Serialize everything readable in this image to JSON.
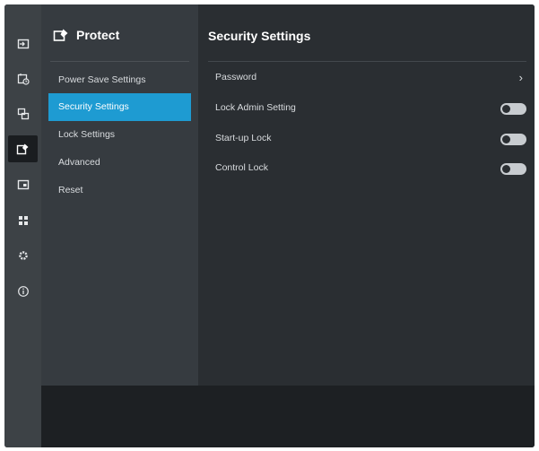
{
  "rail": {
    "icons": [
      {
        "name": "input-icon",
        "active": false
      },
      {
        "name": "schedule-icon",
        "active": false
      },
      {
        "name": "multi-picture-icon",
        "active": false
      },
      {
        "name": "protect-icon",
        "active": true
      },
      {
        "name": "picture-icon",
        "active": false
      },
      {
        "name": "apps-icon",
        "active": false
      },
      {
        "name": "settings-icon",
        "active": false
      },
      {
        "name": "info-icon",
        "active": false
      }
    ]
  },
  "submenu": {
    "title": "Protect",
    "items": [
      {
        "label": "Power Save Settings",
        "selected": false
      },
      {
        "label": "Security Settings",
        "selected": true
      },
      {
        "label": "Lock Settings",
        "selected": false
      },
      {
        "label": "Advanced",
        "selected": false
      },
      {
        "label": "Reset",
        "selected": false
      }
    ]
  },
  "main": {
    "title": "Security Settings",
    "rows": [
      {
        "label": "Password",
        "control": "chevron",
        "chevron": "›"
      },
      {
        "label": "Lock Admin Setting",
        "control": "toggle",
        "on": false
      },
      {
        "label": "Start-up Lock",
        "control": "toggle",
        "on": false
      },
      {
        "label": "Control Lock",
        "control": "toggle",
        "on": false
      }
    ]
  },
  "colors": {
    "accent": "#1e9bd2",
    "background": "#2a2e32",
    "submenu_bg": "#363b40",
    "rail_bg": "#3d4246"
  }
}
